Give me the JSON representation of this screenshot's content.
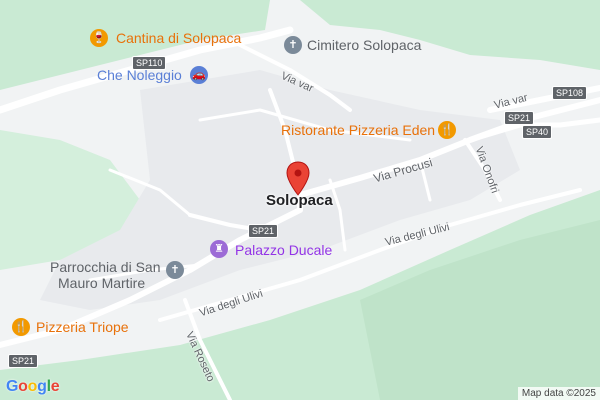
{
  "map": {
    "town_label": "Solopaca",
    "pois": {
      "cantina": "Cantina di Solopaca",
      "cimitero": "Cimitero Solopaca",
      "noleggio": "Che Noleggio",
      "ristorante": "Ristorante Pizzeria Eden",
      "palazzo": "Palazzo Ducale",
      "parrocchia_line1": "Parrocchia di San",
      "parrocchia_line2": "Mauro Martire",
      "pizzeria": "Pizzeria Triope"
    },
    "streets": {
      "via_var_1": "Via var",
      "via_var_2": "Via var",
      "via_procusi": "Via Procusi",
      "via_onofri": "Via Onofri",
      "via_ulivi_1": "Via degli Ulivi",
      "via_ulivi_2": "Via degli Ulivi",
      "via_roseto": "Via Roseto"
    },
    "shields": {
      "sp110": "SP110",
      "sp108": "SP108",
      "sp21_a": "SP21",
      "sp40": "SP40",
      "sp21_b": "SP21",
      "sp21_c": "SP21"
    },
    "logo_letters": [
      "G",
      "o",
      "o",
      "g",
      "l",
      "e"
    ],
    "attribution": "Map data ©2025",
    "colors": {
      "green": "#c9ead3",
      "road": "#ffffff",
      "marker": "#ea4335",
      "poi_food": "#e8710a",
      "poi_purple": "#9334e6"
    }
  }
}
